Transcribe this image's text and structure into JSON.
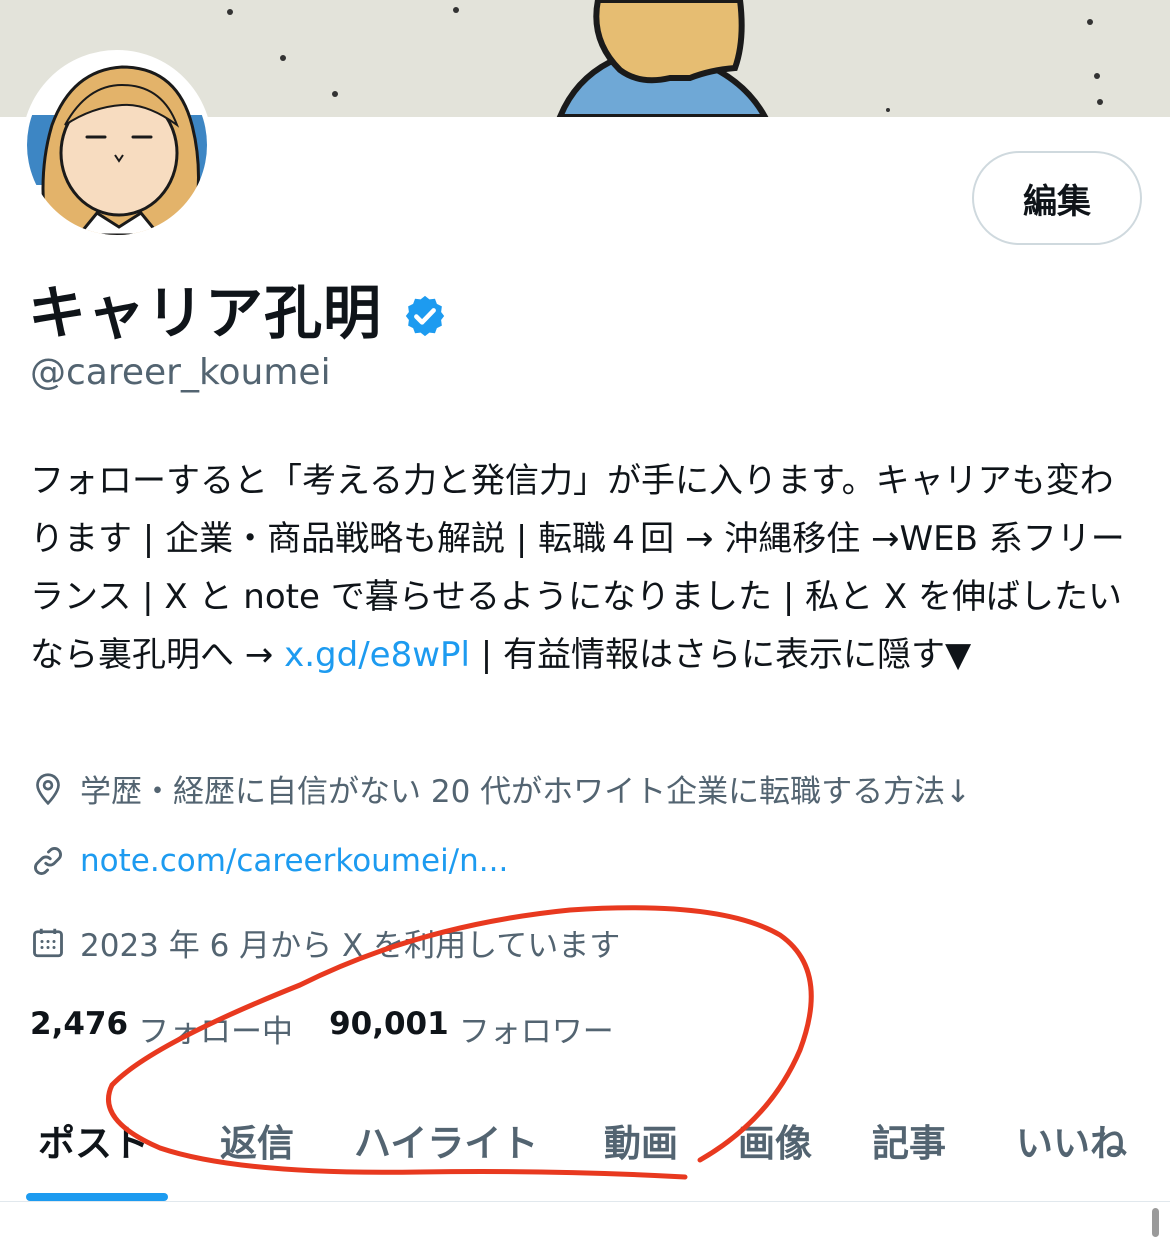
{
  "profile": {
    "display_name": "キャリア孔明",
    "handle": "@career_koumei",
    "edit_label": "編集",
    "bio": {
      "text_before_link": "フォローすると「考える力と発信力」が手に入ります。キャリアも変わります | 企業・商品戦略も解説 | 転職４回 → 沖縄移住 →WEB 系フリーランス | X と note で暮らせるようになりました | 私と X を伸ばしたいなら裏孔明へ → ",
      "link": "x.gd/e8wPl",
      "text_after_link": " | 有益情報はさらに表示に隠す▼"
    },
    "location": "学歴・経歴に自信がない 20 代がホワイト企業に転職する方法↓",
    "website": "note.com/careerkoumei/n...",
    "joined": "2023 年 6 月から X を利用しています",
    "following_count": "2,476",
    "following_label": "フォロー中",
    "followers_count": "90,001",
    "followers_label": "フォロワー"
  },
  "tabs": [
    {
      "label": "ポスト",
      "active": true
    },
    {
      "label": "返信"
    },
    {
      "label": "ハイライト"
    },
    {
      "label": "動画"
    },
    {
      "label": "画像"
    },
    {
      "label": "記事"
    },
    {
      "label": "いいね"
    }
  ],
  "colors": {
    "accent": "#1d9bf0",
    "annotation_stroke": "#e8391f",
    "secondary_text": "#536471"
  },
  "icons": [
    "verified-badge-icon",
    "location-pin-icon",
    "link-icon",
    "calendar-icon"
  ]
}
